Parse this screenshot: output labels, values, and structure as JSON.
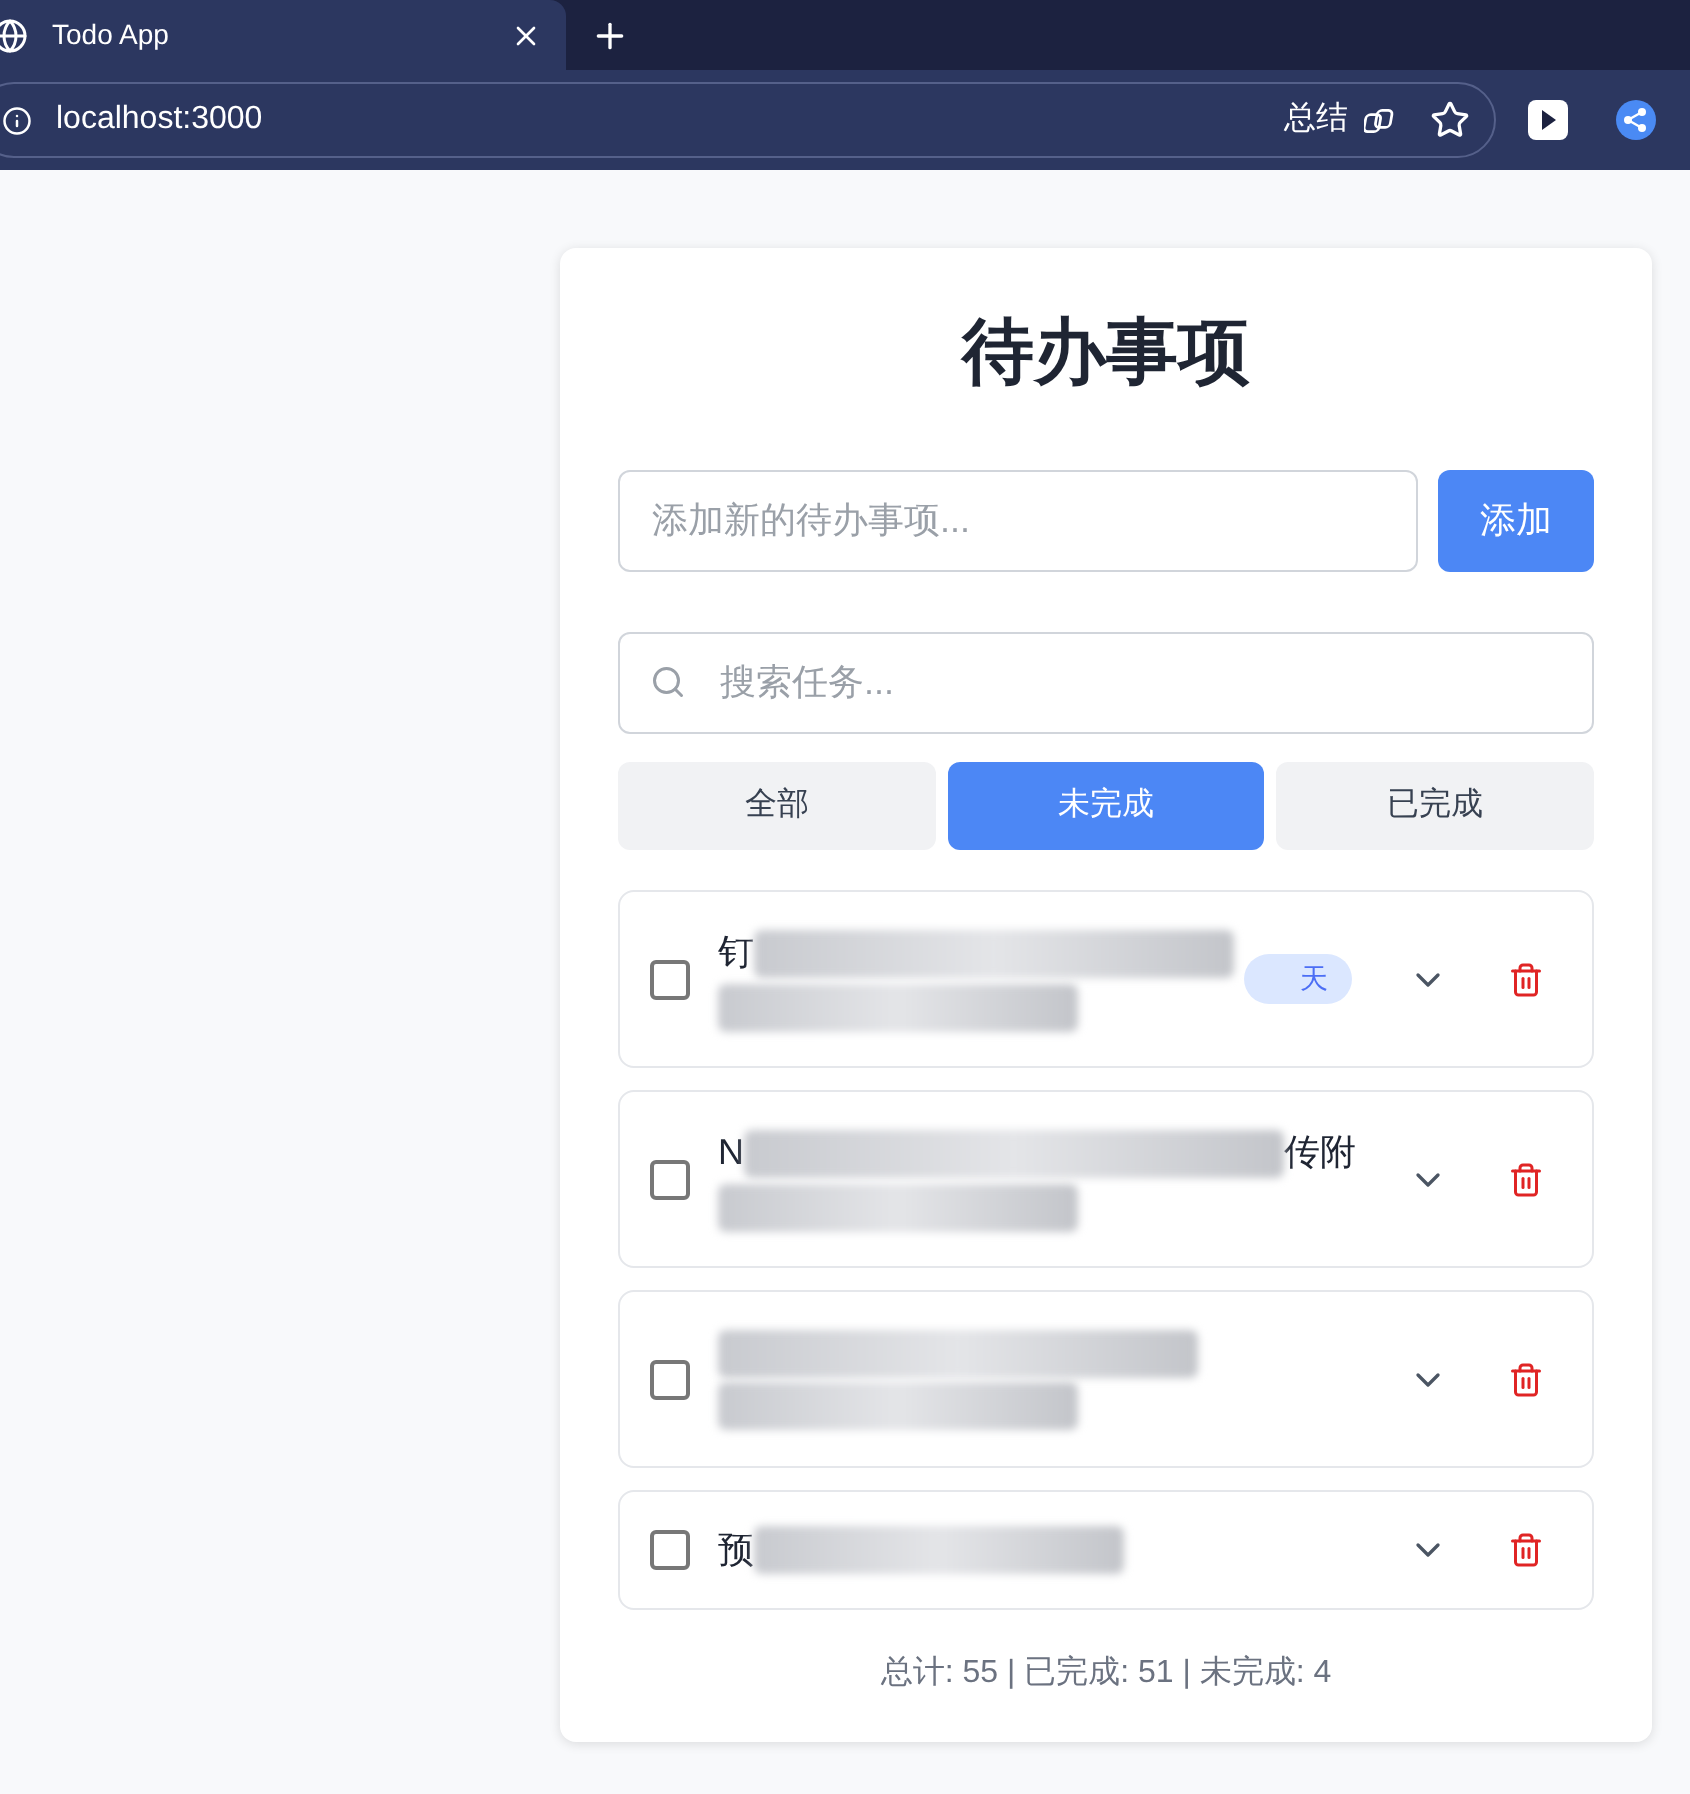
{
  "browser": {
    "tab_title": "Todo App",
    "address": "localhost:3000",
    "summary_label": "总结"
  },
  "title": "待办事项",
  "new_todo": {
    "placeholder": "添加新的待办事项..."
  },
  "add_button": "添加",
  "search": {
    "placeholder": "搜索任务..."
  },
  "filters": [
    {
      "label": "全部",
      "selected": false
    },
    {
      "label": "未完成",
      "selected": true
    },
    {
      "label": "已完成",
      "selected": false
    }
  ],
  "todos": [
    {
      "checked": false,
      "text_start": "钉",
      "second_line": true,
      "badge": "天"
    },
    {
      "checked": false,
      "text_start": "N",
      "text_end": "传附",
      "second_line": true
    },
    {
      "checked": false,
      "second_line": true
    },
    {
      "checked": false,
      "text_start": "预",
      "second_line": false
    }
  ],
  "footer": "总计: 55 | 已完成: 51 | 未完成: 4"
}
